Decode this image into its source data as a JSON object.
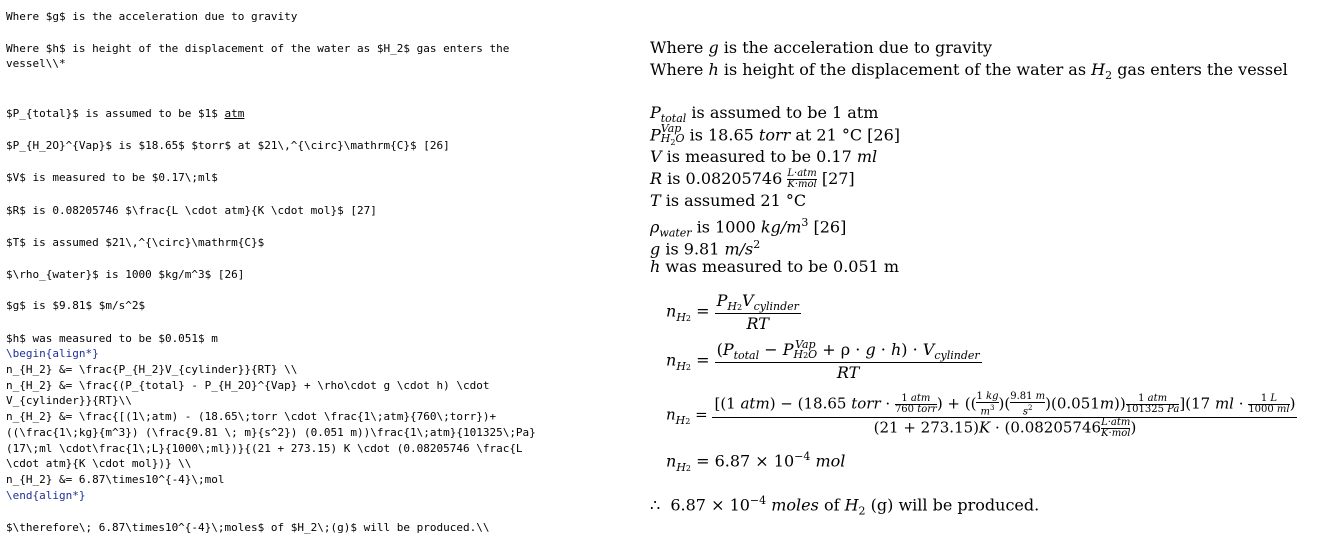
{
  "editor": {
    "lines": [
      "Where $g$ is the acceleration due to gravity",
      "Where $h$ is height of the displacement of the water as $H_2$ gas enters the",
      "vessel\\\\*",
      "$P_{total}$ is assumed to be $1$ ",
      "atm",
      "$P_{H_2O}^{Vap}$ is $18.65$ $torr$ at $21\\,^{\\circ}\\mathrm{C}$ [26]",
      "$V$ is measured to be $0.17\\;ml$",
      "$R$ is 0.08205746 $\\frac{L \\cdot atm}{K \\cdot mol}$ [27]",
      "$T$ is assumed $21\\,^{\\circ}\\mathrm{C}$",
      "$\\rho_{water}$ is 1000 $kg/m^3$ [26]",
      "$g$ is $9.81$ $m/s^2$",
      "$h$ was measured to be $0.051$ m",
      "\\begin{align*}",
      "n_{H_2} &= \\frac{P_{H_2}V_{cylinder}}{RT} \\\\",
      "n_{H_2} &= \\frac{(P_{total} - P_{H_2O}^{Vap} + \\rho\\cdot g \\cdot h) \\cdot",
      "V_{cylinder}}{RT}\\\\",
      "n_{H_2} &= \\frac{[(1\\;atm) - (18.65\\;torr \\cdot \\frac{1\\;atm}{760\\;torr})+",
      "((\\frac{1\\;kg}{m^3}) (\\frac{9.81 \\; m}{s^2}) (0.051 m))\\frac{1\\;atm}{101325\\;Pa}",
      "(17\\;ml \\cdot\\frac{1\\;L}{1000\\;ml})}{(21 + 273.15) K \\cdot (0.08205746 \\frac{L",
      "\\cdot atm}{K \\cdot mol})} \\\\",
      "n_{H_2} &= 6.87\\times10^{-4}\\;mol",
      "\\end{align*}",
      "$\\therefore\\; 6.87\\times10^{-4}\\;moles$ of $H_2\\;(g)$ will be produced.\\\\"
    ]
  },
  "preview": {
    "g_line": "is the acceleration due to gravity",
    "h_line": "is height of the displacement of the water as",
    "h_line_end": "gas enters the vessel",
    "where": "Where",
    "p_total_text": "is assumed to be 1 atm",
    "p_vap_text": "is 18.65",
    "p_vap_unit": "torr",
    "p_vap_at": "at 21 °C [26]",
    "v_text": "is measured to be 0.17",
    "v_unit": "ml",
    "r_text": "is 0.08205746",
    "r_ref": "[27]",
    "t_text": "is assumed 21 °C",
    "rho_text": "is 1000",
    "rho_unit": "kg/m",
    "rho_ref": "[26]",
    "gval_text": "is 9.81",
    "gval_unit": "m/s",
    "hval_text": "was measured to be 0.051 m",
    "eq4_value": "= 6.87 × 10",
    "eq4_exp": "−4",
    "eq4_unit": "mol",
    "conclusion_value": "6.87 × 10",
    "conclusion_exp": "−4",
    "conclusion_unit": "moles",
    "conclusion_of": "of",
    "conclusion_end": "(g) will be produced.",
    "therefore": "∴"
  }
}
